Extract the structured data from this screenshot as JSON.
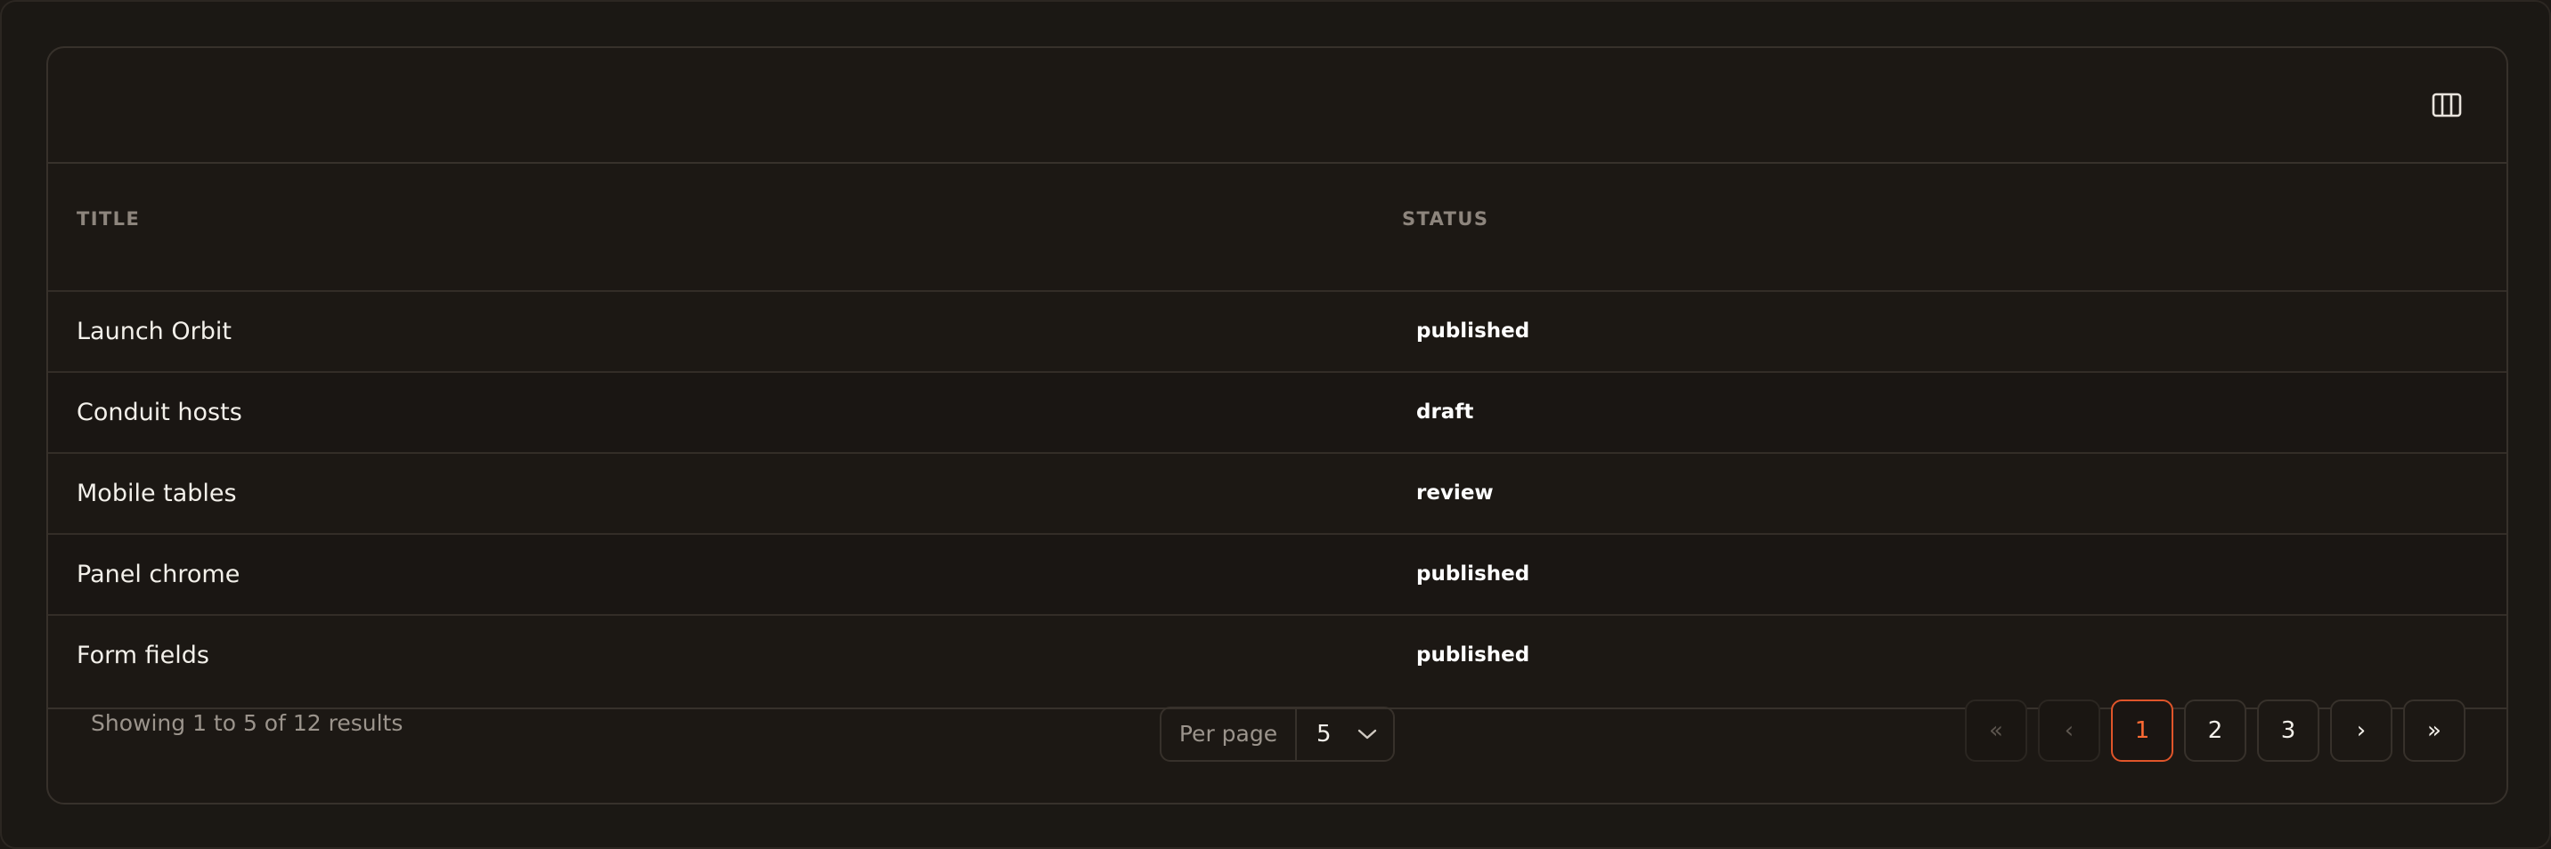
{
  "table": {
    "columns": {
      "title": "TITLE",
      "status": "STATUS"
    },
    "rows": [
      {
        "title": "Launch Orbit",
        "status": "published"
      },
      {
        "title": "Conduit hosts",
        "status": "draft"
      },
      {
        "title": "Mobile tables",
        "status": "review"
      },
      {
        "title": "Panel chrome",
        "status": "published"
      },
      {
        "title": "Form fields",
        "status": "published"
      }
    ]
  },
  "footer": {
    "showing": "Showing 1 to 5 of 12 results",
    "per_page_label": "Per page",
    "per_page_value": "5"
  },
  "pagination": {
    "first": "«",
    "prev": "‹",
    "pages": [
      "1",
      "2",
      "3"
    ],
    "current_page": "1",
    "next": "›",
    "last": "»"
  },
  "icons": {
    "columns_toggle": "columns-icon",
    "select_chevron": "chevron-down-icon"
  },
  "colors": {
    "accent": "#ff6a33",
    "background": "#1c1814",
    "border": "#37312b"
  }
}
